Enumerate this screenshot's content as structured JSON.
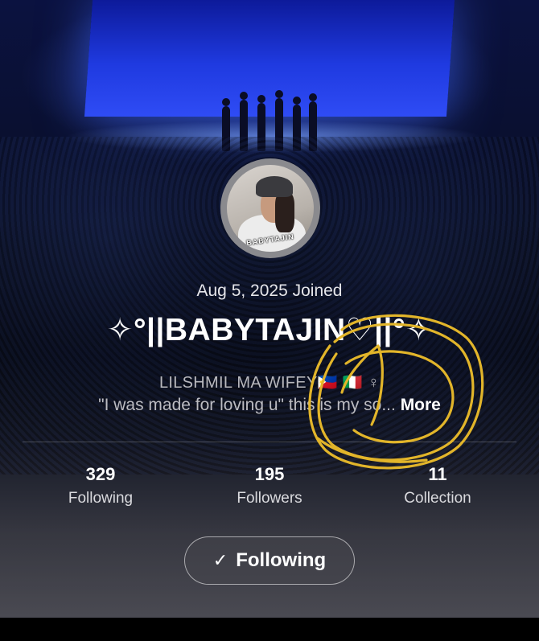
{
  "profile": {
    "joined": "Aug 5, 2025 Joined",
    "username": "✧°||BABYTAJIN♡||°✧",
    "avatar_tag": "BABYTAJIN",
    "bio_line1": "LILSHMIL MA WIFEY🇵🇭 🇮🇹 ♀",
    "bio_line2": "\"I was made for loving u\" this is my so...",
    "more_label": "More"
  },
  "stats": [
    {
      "value": "329",
      "label": "Following"
    },
    {
      "value": "195",
      "label": "Followers"
    },
    {
      "value": "11",
      "label": "Collection"
    }
  ],
  "follow_button": {
    "icon": "✓",
    "label": "Following"
  },
  "colors": {
    "annotation": "#e2b52a",
    "background_accent": "#1f3ae0"
  }
}
